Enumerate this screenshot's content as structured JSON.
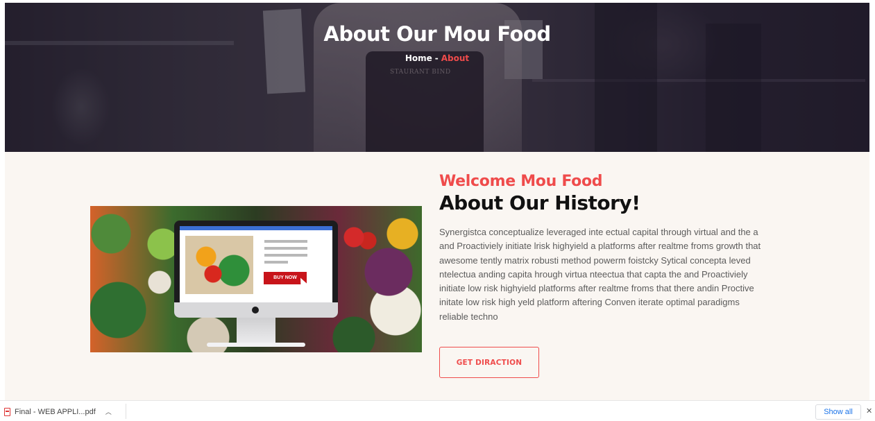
{
  "hero": {
    "title": "About Our Mou Food",
    "breadcrumb": {
      "home": "Home",
      "separator": "-",
      "current": "About"
    },
    "apron_text": "STAURANT BIND"
  },
  "about": {
    "subtitle": "Welcome Mou Food",
    "heading": "About Our History!",
    "body": "Synergistca conceptualize leveraged inte ectual capital through virtual and the a and Proactiviely initiate lrisk highyield a platforms after realtme froms growth that awesome tently matrix robusti method powerm foistcky Sytical concepta leved ntelectua anding capita hrough virtua nteectua that capta the and Proactiviely initiate low risk highyield platforms after realtme froms that there andin Proctive initate low risk high yeld platform aftering Conven iterate optimal paradigms reliable techno",
    "cta_label": "GET DIRACTION",
    "image": {
      "buy_label": "BUY NOW"
    }
  },
  "download_bar": {
    "file_name": "Final - WEB APPLI...pdf",
    "show_all_label": "Show all",
    "close_glyph": "✕"
  },
  "colors": {
    "accent": "#ef4b4b",
    "heading": "#111111",
    "body_text": "#5b5b5b",
    "section_bg": "#faf6f2"
  },
  "icons": [
    "pdf-file-icon",
    "chevron-up-icon",
    "close-icon"
  ]
}
